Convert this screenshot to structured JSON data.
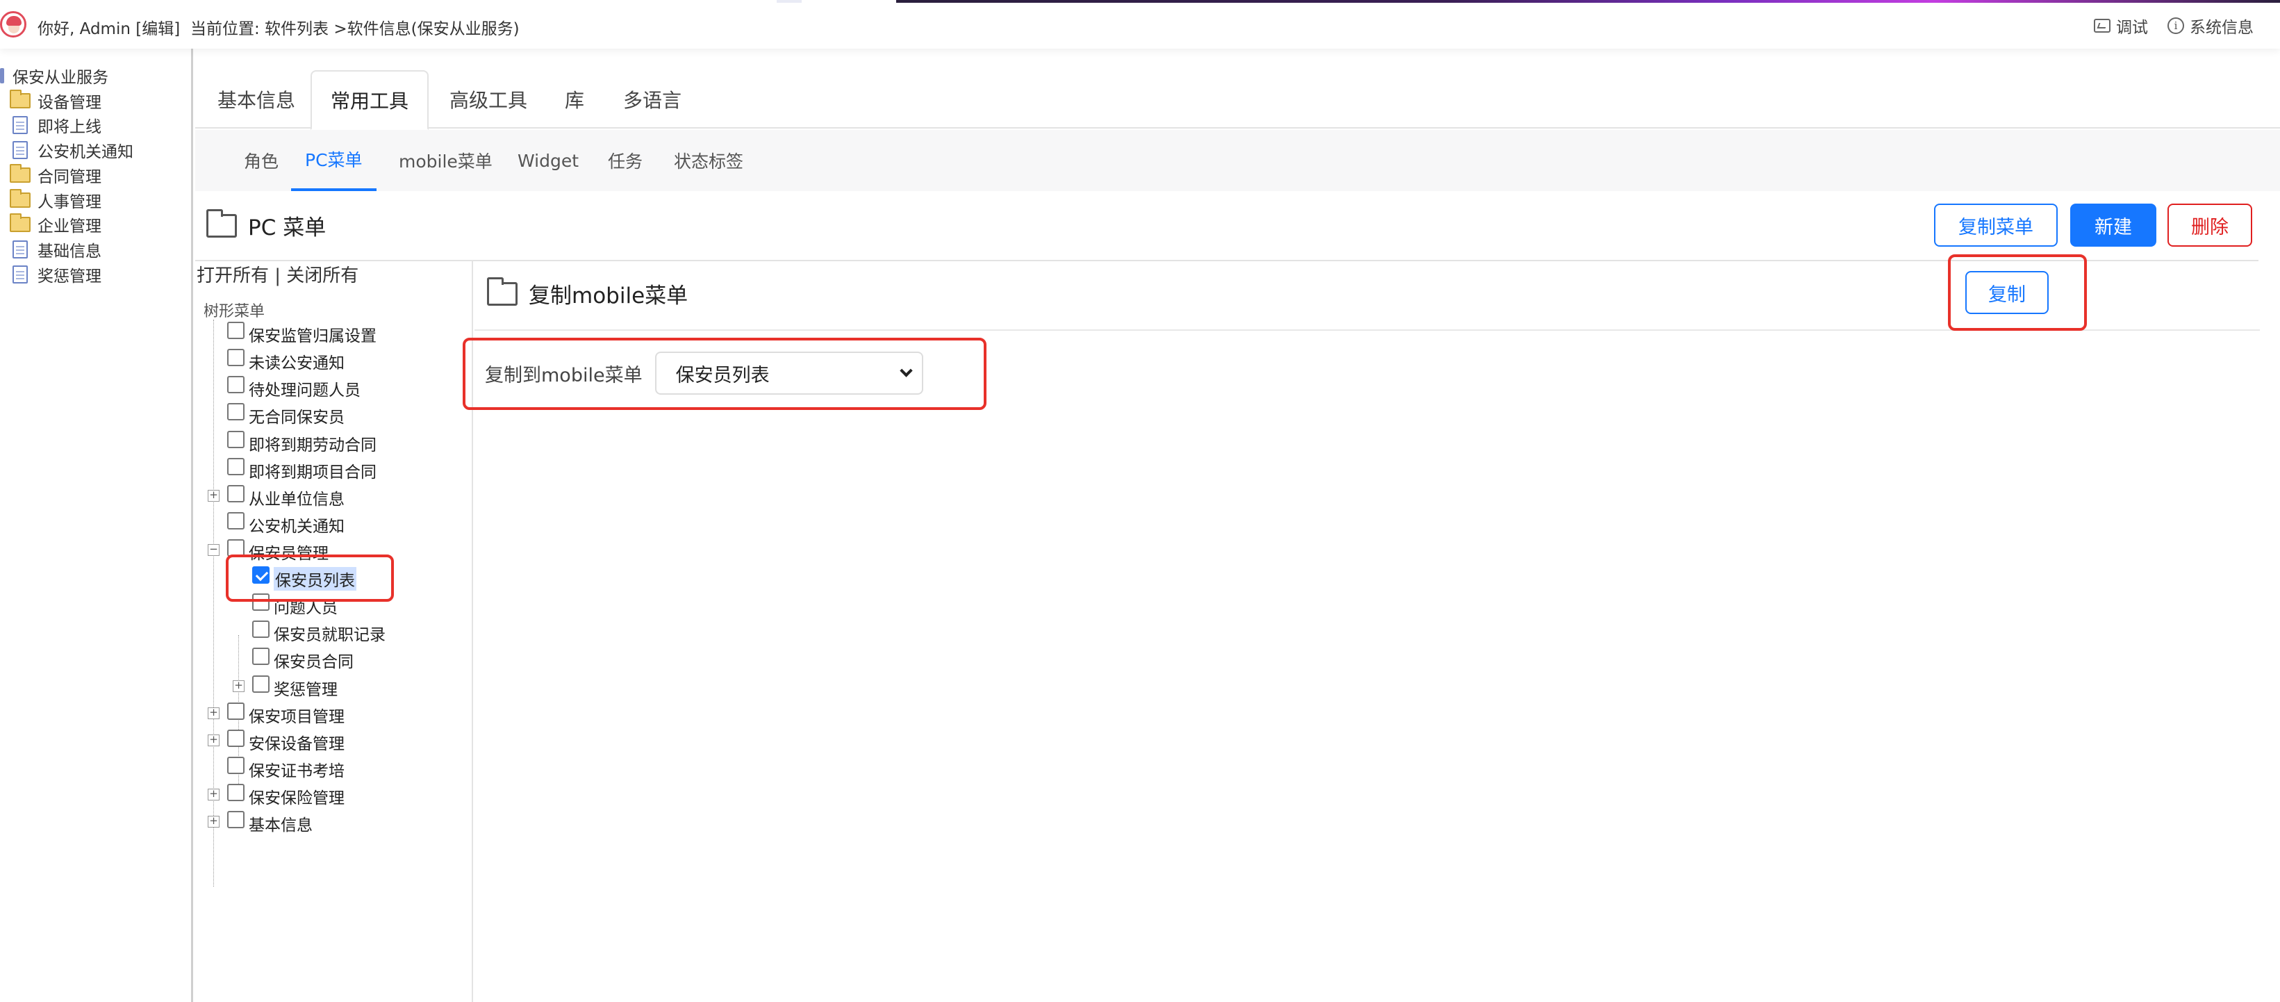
{
  "topbar": {
    "greeting": "你好, Admin [编辑]",
    "breadcrumb": "当前位置: 软件列表 >软件信息(保安从业服务)",
    "actions": {
      "debug": "调试",
      "sysinfo": "系统信息"
    }
  },
  "sidebar": {
    "root": "保安从业服务",
    "items": [
      {
        "label": "设备管理",
        "icon": "folder-icon"
      },
      {
        "label": "即将上线",
        "icon": "doc-icon"
      },
      {
        "label": "公安机关通知",
        "icon": "doc-icon"
      },
      {
        "label": "合同管理",
        "icon": "folder-icon"
      },
      {
        "label": "人事管理",
        "icon": "folder-icon"
      },
      {
        "label": "企业管理",
        "icon": "folder-icon"
      },
      {
        "label": "基础信息",
        "icon": "doc-icon"
      },
      {
        "label": "奖惩管理",
        "icon": "doc-icon"
      }
    ]
  },
  "tabs": [
    {
      "label": "基本信息"
    },
    {
      "label": "常用工具",
      "active": true
    },
    {
      "label": "高级工具"
    },
    {
      "label": "库"
    },
    {
      "label": "多语言"
    }
  ],
  "subtabs": [
    {
      "label": "角色"
    },
    {
      "label": "PC菜单",
      "active": true
    },
    {
      "label": "mobile菜单"
    },
    {
      "label": "Widget"
    },
    {
      "label": "任务"
    },
    {
      "label": "状态标签"
    }
  ],
  "section": {
    "title": "PC 菜单",
    "buttons": {
      "copy_menu": "复制菜单",
      "new": "新建",
      "delete": "删除"
    }
  },
  "tree": {
    "toggle_text": "打开所有 | 关闭所有",
    "caption": "树形菜单",
    "nodes": [
      {
        "label": "保安监管归属设置",
        "checked": false
      },
      {
        "label": "未读公安通知",
        "checked": false
      },
      {
        "label": "待处理问题人员",
        "checked": false
      },
      {
        "label": "无合同保安员",
        "checked": false
      },
      {
        "label": "即将到期劳动合同",
        "checked": false
      },
      {
        "label": "即将到期项目合同",
        "checked": false
      },
      {
        "label": "从业单位信息",
        "checked": false,
        "expander": "+"
      },
      {
        "label": "公安机关通知",
        "checked": false
      },
      {
        "label": "保安员管理",
        "checked": false,
        "expander": "-"
      },
      {
        "label": "保安员列表",
        "checked": true,
        "selected": true
      },
      {
        "label": "问题人员",
        "checked": false
      },
      {
        "label": "保安员就职记录",
        "checked": false
      },
      {
        "label": "保安员合同",
        "checked": false
      },
      {
        "label": "奖惩管理",
        "checked": false,
        "expander": "+"
      },
      {
        "label": "保安项目管理",
        "checked": false,
        "expander": "+"
      },
      {
        "label": "安保设备管理",
        "checked": false,
        "expander": "+"
      },
      {
        "label": "保安证书考培",
        "checked": false
      },
      {
        "label": "保安保险管理",
        "checked": false,
        "expander": "+"
      },
      {
        "label": "基本信息",
        "checked": false,
        "expander": "+"
      }
    ]
  },
  "content": {
    "title": "复制mobile菜单",
    "copy_button": "复制",
    "form": {
      "label": "复制到mobile菜单",
      "selected_value": "保安员列表"
    }
  },
  "colors": {
    "accent": "#1677ff",
    "danger": "#e02020",
    "highlight_box": "#e8312a"
  }
}
